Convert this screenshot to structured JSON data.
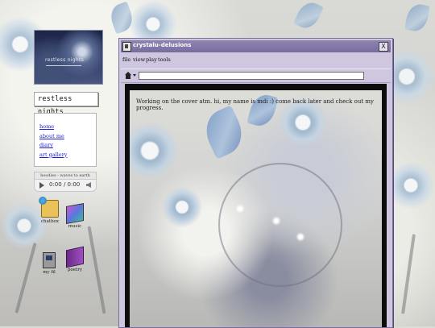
{
  "banner": {
    "caption": "restless nights"
  },
  "sidebar": {
    "title": "restless nights",
    "nav": [
      {
        "label": "home"
      },
      {
        "label": "about me"
      },
      {
        "label": "diary"
      },
      {
        "label": "art gallery"
      }
    ]
  },
  "player": {
    "track": "hoodies - waves to earth",
    "time": "0:00 / 0:00"
  },
  "desktop_icons": [
    {
      "label": "chatbox",
      "icon": "globe-folder-icon"
    },
    {
      "label": "music",
      "icon": "music-cd-icon"
    },
    {
      "label": "my fil",
      "icon": "computer-icon"
    },
    {
      "label": "poetry",
      "icon": "book-icon"
    }
  ],
  "window": {
    "title": "crystalu-delusions",
    "close_label": "X",
    "menu": [
      "file",
      "view",
      "play",
      "tools"
    ],
    "address": "",
    "content_text": "Working on the cover atm. hi, my name is mdi :) come back later and check out my progress."
  },
  "colors": {
    "titlebar": "#786d9c",
    "window_bg": "#cfc6e0",
    "link": "#1a1ad8"
  }
}
